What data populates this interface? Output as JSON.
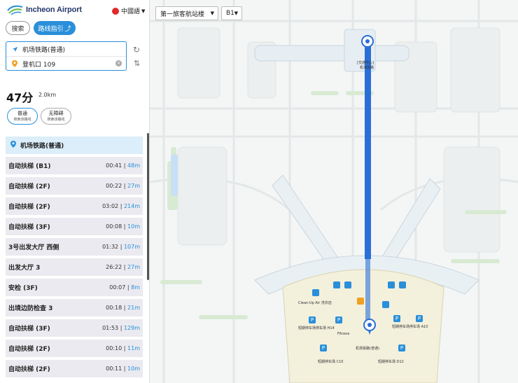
{
  "header": {
    "logo_text": "Incheon Airport",
    "language": "中國語"
  },
  "tabs": {
    "search": "搜索",
    "route": "路线指引"
  },
  "route": {
    "origin": "机场铁路(普通)",
    "destination": "登机口 109",
    "duration": "47分",
    "distance": "2.0km"
  },
  "options": [
    {
      "label": "普通",
      "sub": "搜索该路线"
    },
    {
      "label": "无障碍",
      "sub": "搜索该路线"
    }
  ],
  "steps_header": "机场铁路(普通)",
  "steps": [
    {
      "name": "自动扶梯 (B1)",
      "time": "00:41",
      "dist": "48m"
    },
    {
      "name": "自动扶梯 (2F)",
      "time": "00:22",
      "dist": "27m"
    },
    {
      "name": "自动扶梯 (2F)",
      "time": "03:02",
      "dist": "214m"
    },
    {
      "name": "自动扶梯 (3F)",
      "time": "00:08",
      "dist": "10m"
    },
    {
      "name": "3号出发大厅 西侧",
      "time": "01:32",
      "dist": "107m"
    },
    {
      "name": "出发大厅 3",
      "time": "26:22",
      "dist": "27m"
    },
    {
      "name": "安检 (3F)",
      "time": "00:07",
      "dist": "8m"
    },
    {
      "name": "出境边防检查 3",
      "time": "00:18",
      "dist": "21m"
    },
    {
      "name": "自动扶梯 (3F)",
      "time": "01:53",
      "dist": "129m"
    },
    {
      "name": "自动扶梯 (2F)",
      "time": "00:10",
      "dist": "11m"
    },
    {
      "name": "自动扶梯 (2F)",
      "time": "00:11",
      "dist": "10m"
    }
  ],
  "map": {
    "terminal_select": "第一旅客航站楼",
    "floor_select": "B1",
    "labels": {
      "start_top": "[交通中心]",
      "start_sub": "机场铁路",
      "cleanup": "Clean-Up Air 洗衣店",
      "parking_h14": "短期停车场停车场 H14",
      "parking_a10": "短期停车场停车场 A10",
      "parking_c10": "短期停车场 C10",
      "parking_d12": "短期停车场 D12",
      "airline": "机场铁路(普通)",
      "fitness": "Fitness"
    }
  },
  "colors": {
    "accent": "#2a8fd9",
    "route": "#2a6fd6",
    "list_bg": "#eaeaf0"
  }
}
